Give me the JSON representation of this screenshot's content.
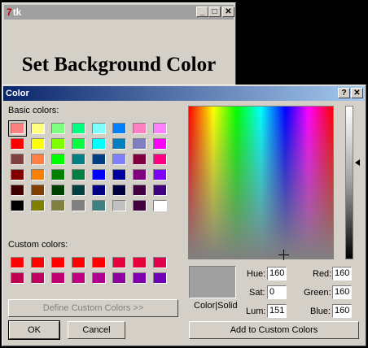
{
  "tk_window": {
    "title": "tk",
    "heading": "Set Background Color",
    "buttons": {
      "minimize": "_",
      "maximize": "□",
      "close": "✕"
    }
  },
  "dialog": {
    "title": "Color",
    "help_btn": "?",
    "close_btn": "✕",
    "basic_colors_label": "Basic colors:",
    "custom_colors_label": "Custom colors:",
    "basic_colors": [
      "#ff8080",
      "#ffff80",
      "#80ff80",
      "#00ff80",
      "#80ffff",
      "#0080ff",
      "#ff80c0",
      "#ff80ff",
      "#ff0000",
      "#ffff00",
      "#80ff00",
      "#00ff40",
      "#00ffff",
      "#0080c0",
      "#8080c0",
      "#ff00ff",
      "#804040",
      "#ff8040",
      "#00ff00",
      "#008080",
      "#004080",
      "#8080ff",
      "#800040",
      "#ff0080",
      "#800000",
      "#ff8000",
      "#008000",
      "#008040",
      "#0000ff",
      "#0000a0",
      "#800080",
      "#8000ff",
      "#400000",
      "#804000",
      "#004000",
      "#004040",
      "#000080",
      "#000040",
      "#400040",
      "#400080",
      "#000000",
      "#808000",
      "#808040",
      "#808080",
      "#408080",
      "#c0c0c0",
      "#400040",
      "#ffffff"
    ],
    "custom_colors": [
      "#ff0000",
      "#ff0000",
      "#ff0000",
      "#ff0000",
      "#ff0000",
      "#e8003a",
      "#e8003a",
      "#e0004c",
      "#c00050",
      "#c00060",
      "#c00070",
      "#c00080",
      "#b00090",
      "#9000a0",
      "#8000b0",
      "#7000b8"
    ],
    "define_custom_label": "Define Custom Colors >>",
    "ok_label": "OK",
    "cancel_label": "Cancel",
    "color_solid_label": "Color|Solid",
    "hue_label": "Hue:",
    "hue": "160",
    "sat_label": "Sat:",
    "sat": "0",
    "lum_label": "Lum:",
    "lum": "151",
    "red_label": "Red:",
    "red": "160",
    "green_label": "Green:",
    "green": "160",
    "blue_label": "Blue:",
    "blue": "160",
    "add_custom_label": "Add to Custom Colors",
    "preview_color": "#a0a0a0"
  }
}
